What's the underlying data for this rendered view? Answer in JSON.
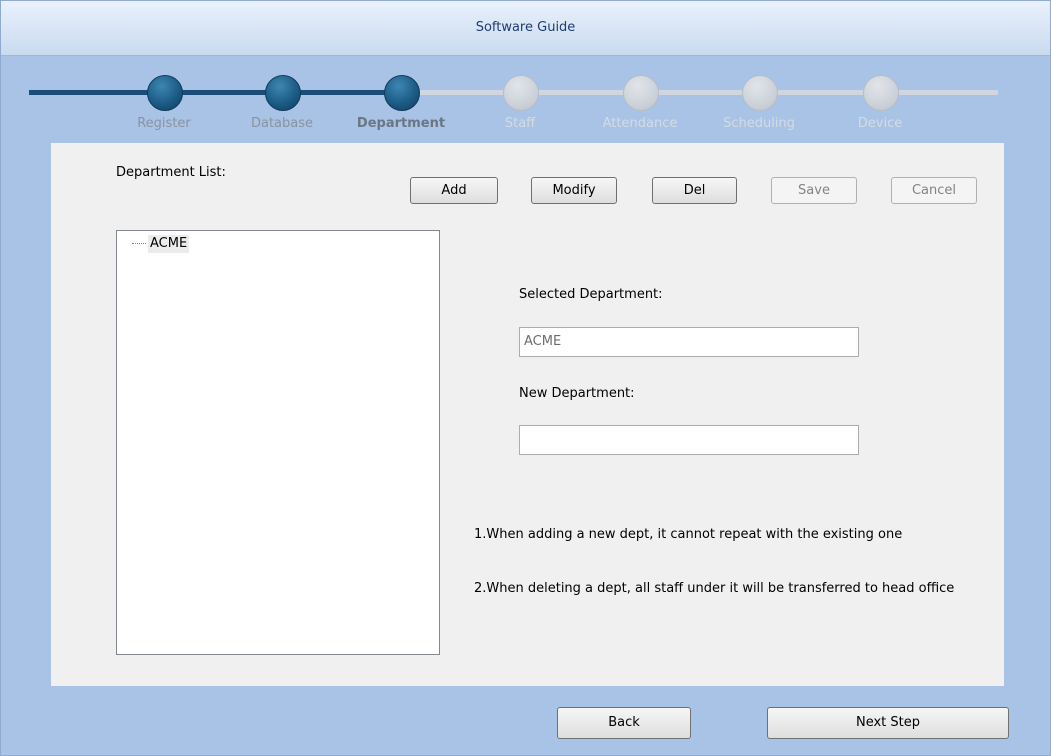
{
  "window": {
    "title": "Software Guide"
  },
  "wizard": {
    "steps": [
      {
        "label": "Register",
        "state": "done"
      },
      {
        "label": "Database",
        "state": "done"
      },
      {
        "label": "Department",
        "state": "current"
      },
      {
        "label": "Staff",
        "state": "todo"
      },
      {
        "label": "Attendance",
        "state": "todo"
      },
      {
        "label": "Scheduling",
        "state": "todo"
      },
      {
        "label": "Device",
        "state": "todo"
      }
    ]
  },
  "department": {
    "list_label": "Department List:",
    "tree_items": [
      "ACME"
    ],
    "buttons": {
      "add": "Add",
      "modify": "Modify",
      "del": "Del",
      "save": "Save",
      "cancel": "Cancel"
    },
    "selected_label": "Selected Department:",
    "selected_value": "ACME",
    "new_label": "New Department:",
    "new_value": "",
    "notes": [
      "1.When adding a new dept, it cannot repeat with the existing one",
      "2.When deleting a dept, all staff under it will be transferred to head office"
    ]
  },
  "footer": {
    "back": "Back",
    "next": "Next Step"
  },
  "colors": {
    "done": "#1c5c86",
    "todo": "#c9ced6",
    "background": "#a9c3e6"
  }
}
